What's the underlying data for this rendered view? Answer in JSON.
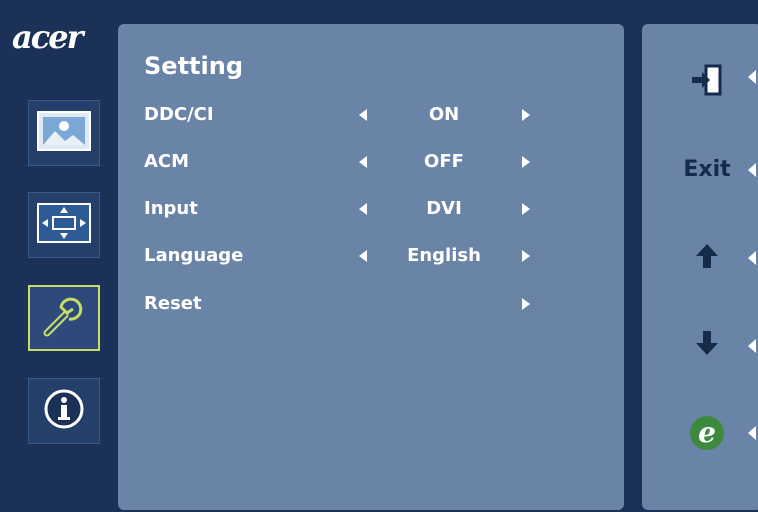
{
  "brand": {
    "logo_text": "acer"
  },
  "sidebar": {
    "items": [
      {
        "name": "picture",
        "icon": "image-icon"
      },
      {
        "name": "position",
        "icon": "position-arrows-icon"
      },
      {
        "name": "setting",
        "icon": "wrench-icon",
        "active": true
      },
      {
        "name": "information",
        "icon": "info-icon"
      }
    ]
  },
  "panel": {
    "title": "Setting",
    "rows": [
      {
        "label": "DDC/CI",
        "value": "ON"
      },
      {
        "label": "ACM",
        "value": "OFF"
      },
      {
        "label": "Input",
        "value": "DVI"
      },
      {
        "label": "Language",
        "value": "English"
      },
      {
        "label": "Reset",
        "value": ""
      }
    ]
  },
  "keys": {
    "exit_icon": "exit-door-icon",
    "exit_label": "Exit",
    "up_icon": "arrow-up-icon",
    "down_icon": "arrow-down-icon",
    "e_icon": "empowering-key-icon",
    "e_label": "e"
  },
  "colors": {
    "background": "#1b3157",
    "panel": "#6a84a8",
    "active_border": "#c8dc6a",
    "e_badge": "#3d8a3e"
  }
}
